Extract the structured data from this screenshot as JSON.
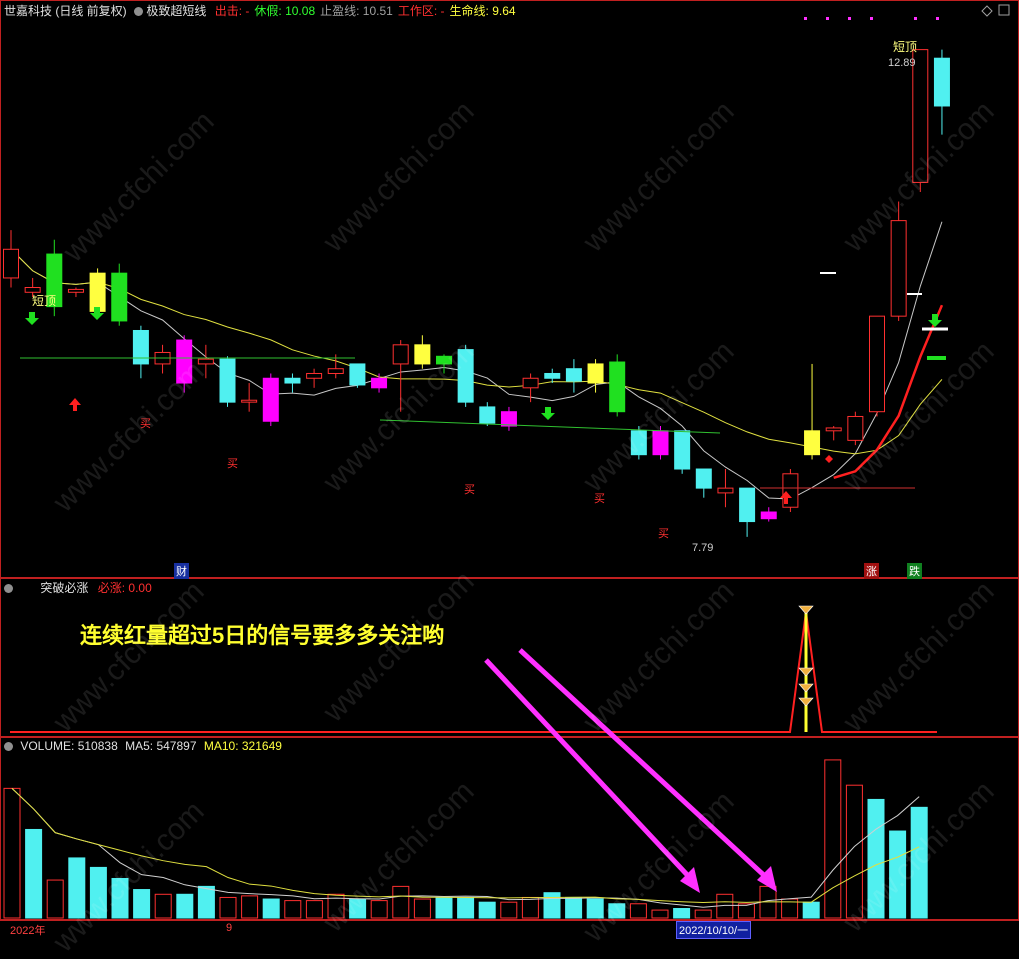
{
  "main_header": {
    "stock": "世嘉科技 (日线 前复权)",
    "indicator": "极致超短线",
    "items": [
      {
        "label": "出击:",
        "value": "-",
        "color": "#ff3030"
      },
      {
        "label": "休假:",
        "value": "10.08",
        "color": "#30ff30"
      },
      {
        "label": "止盈线:",
        "value": "10.51",
        "color": "#a0a0a0"
      },
      {
        "label": "工作区:",
        "value": "-",
        "color": "#ff3030"
      },
      {
        "label": "生命线:",
        "value": "9.64",
        "color": "#ffff40"
      }
    ]
  },
  "sub1_header": {
    "name": "突破必涨",
    "label": "必涨:",
    "value": "0.00"
  },
  "vol_header": {
    "name": "VOLUME:",
    "value": "510838",
    "ma5_label": "MA5:",
    "ma5": "547897",
    "ma10_label": "MA10:",
    "ma10": "321649"
  },
  "annotation_text": "连续红量超过5日的信号要多多关注哟",
  "labels": {
    "short_top_left": "短顶",
    "short_top_right": "短顶",
    "high_price": "12.89",
    "low_price": "7.79",
    "buy": "买",
    "cai": "财",
    "zhang": "涨",
    "die": "跌"
  },
  "x_axis": {
    "start": "2022年",
    "month": "9",
    "selected": "2022/10/10/一"
  },
  "watermark": "www.cfchi.com",
  "colors": {
    "up": "#ff3030",
    "down_cyan": "#50f0f0",
    "yellow_body": "#ffff40",
    "magenta_body": "#ff00ff",
    "green_body": "#20e020",
    "border": "#c02020"
  },
  "chart_data": {
    "type": "candlestick",
    "ohlc": [
      [
        10.5,
        11.0,
        10.4,
        10.8,
        "up"
      ],
      [
        10.4,
        10.5,
        10.3,
        10.35,
        "up"
      ],
      [
        10.75,
        10.9,
        10.1,
        10.2,
        "green"
      ],
      [
        10.35,
        10.4,
        10.3,
        10.38,
        "up"
      ],
      [
        10.15,
        10.6,
        10.1,
        10.55,
        "yellow"
      ],
      [
        10.55,
        10.65,
        10.0,
        10.05,
        "green"
      ],
      [
        9.95,
        10.0,
        9.45,
        9.6,
        "cyan"
      ],
      [
        9.6,
        9.8,
        9.5,
        9.72,
        "up"
      ],
      [
        9.85,
        9.9,
        9.3,
        9.4,
        "magenta"
      ],
      [
        9.65,
        9.8,
        9.45,
        9.6,
        "up"
      ],
      [
        9.65,
        9.68,
        9.15,
        9.2,
        "cyan"
      ],
      [
        9.2,
        9.4,
        9.1,
        9.22,
        "up"
      ],
      [
        9.45,
        9.5,
        8.95,
        9.0,
        "magenta"
      ],
      [
        9.4,
        9.5,
        9.3,
        9.45,
        "cyan"
      ],
      [
        9.45,
        9.55,
        9.35,
        9.5,
        "up"
      ],
      [
        9.5,
        9.7,
        9.45,
        9.55,
        "up"
      ],
      [
        9.6,
        9.6,
        9.35,
        9.38,
        "cyan"
      ],
      [
        9.45,
        9.5,
        9.3,
        9.35,
        "magenta"
      ],
      [
        9.6,
        9.85,
        9.1,
        9.8,
        "up"
      ],
      [
        9.8,
        9.9,
        9.55,
        9.6,
        "yellow"
      ],
      [
        9.6,
        9.7,
        9.5,
        9.68,
        "green"
      ],
      [
        9.75,
        9.8,
        9.15,
        9.2,
        "cyan"
      ],
      [
        9.15,
        9.2,
        8.95,
        8.98,
        "cyan"
      ],
      [
        9.1,
        9.15,
        8.9,
        8.95,
        "magenta"
      ],
      [
        9.35,
        9.5,
        9.2,
        9.45,
        "up"
      ],
      [
        9.45,
        9.55,
        9.4,
        9.5,
        "cyan"
      ],
      [
        9.55,
        9.65,
        9.3,
        9.42,
        "cyan"
      ],
      [
        9.4,
        9.65,
        9.3,
        9.6,
        "yellow"
      ],
      [
        9.62,
        9.7,
        9.05,
        9.1,
        "green"
      ],
      [
        8.9,
        8.95,
        8.6,
        8.65,
        "cyan"
      ],
      [
        8.65,
        8.95,
        8.6,
        8.9,
        "magenta"
      ],
      [
        8.9,
        8.9,
        8.45,
        8.5,
        "cyan"
      ],
      [
        8.5,
        8.5,
        8.2,
        8.3,
        "cyan"
      ],
      [
        8.3,
        8.5,
        8.1,
        8.25,
        "up"
      ],
      [
        8.3,
        8.3,
        7.79,
        7.95,
        "cyan"
      ],
      [
        8.05,
        8.1,
        7.95,
        7.98,
        "magenta"
      ],
      [
        8.1,
        8.5,
        8.05,
        8.45,
        "up"
      ],
      [
        8.65,
        9.6,
        8.6,
        8.9,
        "yellow"
      ],
      [
        8.9,
        8.95,
        8.8,
        8.93,
        "up"
      ],
      [
        8.8,
        9.1,
        8.75,
        9.05,
        "up"
      ],
      [
        9.1,
        10.1,
        9.05,
        10.1,
        "up"
      ],
      [
        10.1,
        11.3,
        10.05,
        11.1,
        "up"
      ],
      [
        11.5,
        12.89,
        11.4,
        12.89,
        "up"
      ],
      [
        12.8,
        12.89,
        12.0,
        12.3,
        "cyan"
      ]
    ],
    "volume": [
      [
        0.82,
        "up"
      ],
      [
        0.56,
        "cyan"
      ],
      [
        0.24,
        "up"
      ],
      [
        0.38,
        "cyan"
      ],
      [
        0.32,
        "cyan"
      ],
      [
        0.25,
        "cyan"
      ],
      [
        0.18,
        "cyan"
      ],
      [
        0.15,
        "up"
      ],
      [
        0.15,
        "cyan"
      ],
      [
        0.2,
        "cyan"
      ],
      [
        0.13,
        "up"
      ],
      [
        0.14,
        "up"
      ],
      [
        0.12,
        "cyan"
      ],
      [
        0.11,
        "up"
      ],
      [
        0.11,
        "up"
      ],
      [
        0.15,
        "up"
      ],
      [
        0.12,
        "cyan"
      ],
      [
        0.11,
        "up"
      ],
      [
        0.2,
        "up"
      ],
      [
        0.12,
        "up"
      ],
      [
        0.13,
        "cyan"
      ],
      [
        0.13,
        "cyan"
      ],
      [
        0.1,
        "cyan"
      ],
      [
        0.1,
        "up"
      ],
      [
        0.13,
        "up"
      ],
      [
        0.16,
        "cyan"
      ],
      [
        0.13,
        "cyan"
      ],
      [
        0.12,
        "cyan"
      ],
      [
        0.09,
        "cyan"
      ],
      [
        0.09,
        "up"
      ],
      [
        0.05,
        "up"
      ],
      [
        0.06,
        "cyan"
      ],
      [
        0.05,
        "up"
      ],
      [
        0.15,
        "up"
      ],
      [
        0.09,
        "up"
      ],
      [
        0.2,
        "up"
      ],
      [
        0.12,
        "up"
      ],
      [
        0.1,
        "cyan"
      ],
      [
        1.0,
        "up"
      ],
      [
        0.84,
        "up"
      ],
      [
        0.75,
        "cyan"
      ],
      [
        0.55,
        "cyan"
      ],
      [
        0.7,
        "cyan"
      ]
    ],
    "ylim_price": [
      7.6,
      13.2
    ],
    "ylim_volume": [
      0,
      1.05
    ]
  }
}
